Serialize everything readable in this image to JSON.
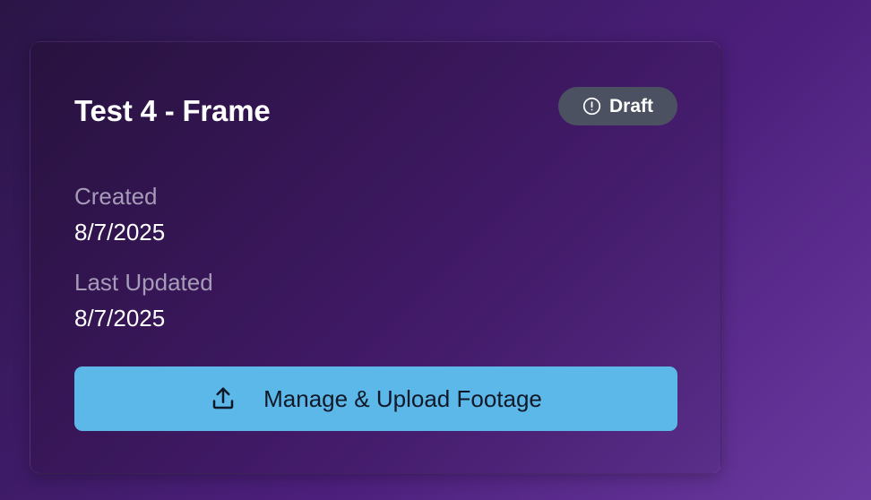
{
  "card": {
    "title": "Test 4 - Frame",
    "status": {
      "label": "Draft",
      "icon": "exclamation-circle-icon",
      "color": "#4b5160"
    },
    "created": {
      "label": "Created",
      "value": "8/7/2025"
    },
    "last_updated": {
      "label": "Last Updated",
      "value": "8/7/2025"
    },
    "action": {
      "label": "Manage & Upload Footage",
      "icon": "upload-icon",
      "color": "#5cb8e8"
    }
  }
}
